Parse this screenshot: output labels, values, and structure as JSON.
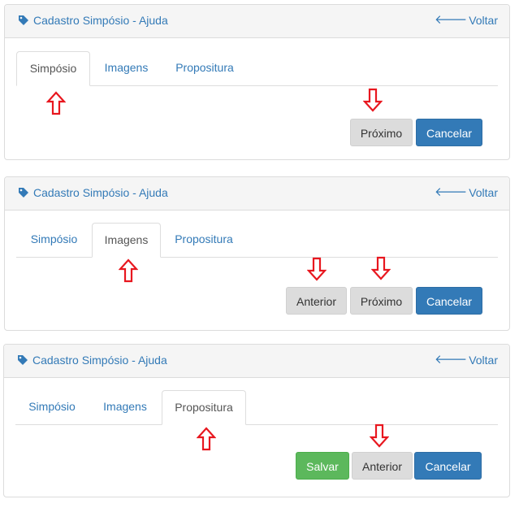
{
  "panels": [
    {
      "title": "Cadastro Simpósio - Ajuda",
      "back_label": "Voltar",
      "tabs": [
        "Simpósio",
        "Imagens",
        "Propositura"
      ],
      "active_tab": "Simpósio",
      "buttons": {
        "next": "Próximo",
        "cancel": "Cancelar"
      }
    },
    {
      "title": "Cadastro Simpósio - Ajuda",
      "back_label": "Voltar",
      "tabs": [
        "Simpósio",
        "Imagens",
        "Propositura"
      ],
      "active_tab": "Imagens",
      "buttons": {
        "previous": "Anterior",
        "next": "Próximo",
        "cancel": "Cancelar"
      }
    },
    {
      "title": "Cadastro Simpósio - Ajuda",
      "back_label": "Voltar",
      "tabs": [
        "Simpósio",
        "Imagens",
        "Propositura"
      ],
      "active_tab": "Propositura",
      "buttons": {
        "save": "Salvar",
        "previous": "Anterior",
        "cancel": "Cancelar"
      }
    }
  ],
  "colors": {
    "link": "#337ab7",
    "primary": "#337ab7",
    "success": "#5cb85c",
    "default_button": "#dcdcdc",
    "annotation_arrow": "#e8171f"
  },
  "icons": {
    "title": "tag-icon",
    "back": "arrow-left-icon",
    "annotation_up": "hollow-up-arrow-icon",
    "annotation_down": "hollow-down-arrow-icon"
  }
}
